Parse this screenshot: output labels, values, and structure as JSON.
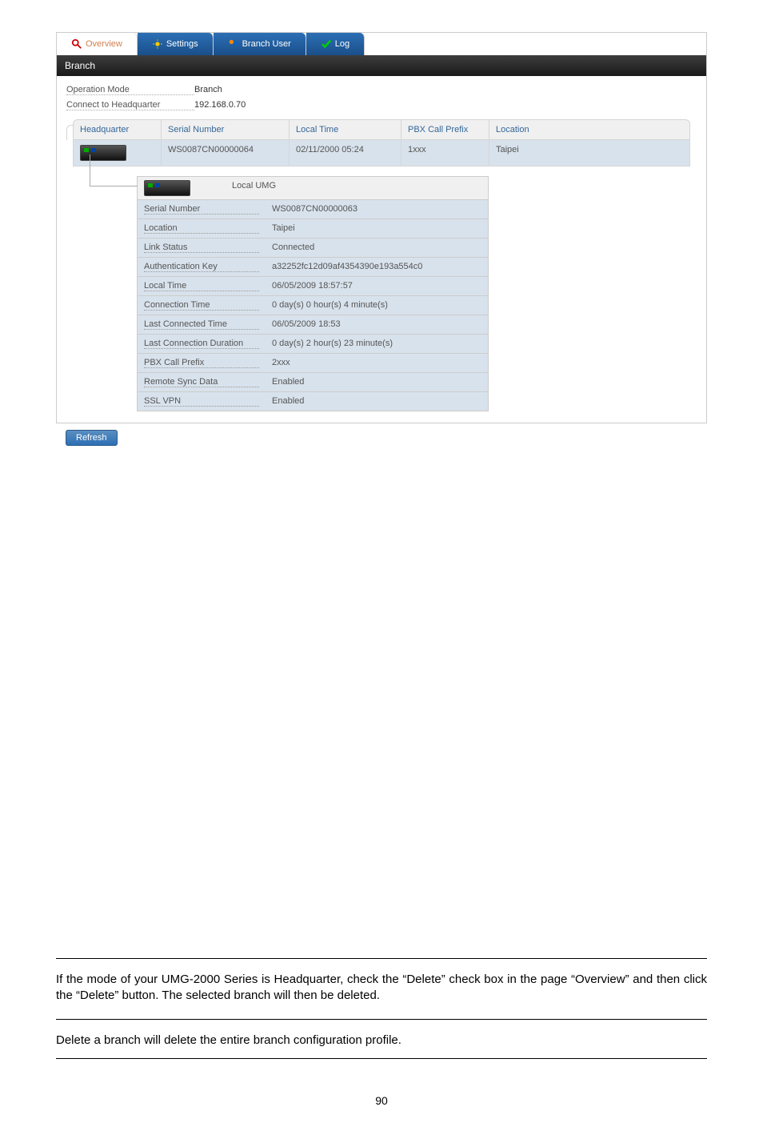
{
  "tabs": {
    "overview": "Overview",
    "settings": "Settings",
    "branch_user": "Branch User",
    "log": "Log"
  },
  "section_title": "Branch",
  "info": {
    "op_mode_label": "Operation Mode",
    "op_mode_value": "Branch",
    "connect_label": "Connect to Headquarter",
    "connect_value": "192.168.0.70"
  },
  "table_headers": {
    "hq": "Headquarter",
    "sn": "Serial Number",
    "lt": "Local Time",
    "pbx": "PBX Call Prefix",
    "loc": "Location"
  },
  "table_row": {
    "sn": "WS0087CN00000064",
    "lt": "02/11/2000 05:24",
    "pbx": "1xxx",
    "loc": "Taipei"
  },
  "detail_header": "Local UMG",
  "details": [
    {
      "label": "Serial Number",
      "value": "WS0087CN00000063"
    },
    {
      "label": "Location",
      "value": "Taipei"
    },
    {
      "label": "Link Status",
      "value": "Connected"
    },
    {
      "label": "Authentication Key",
      "value": "a32252fc12d09af4354390e193a554c0"
    },
    {
      "label": "Local Time",
      "value": "06/05/2009 18:57:57"
    },
    {
      "label": "Connection Time",
      "value": "0 day(s) 0 hour(s) 4 minute(s)"
    },
    {
      "label": "Last Connected Time",
      "value": "06/05/2009 18:53"
    },
    {
      "label": "Last Connection Duration",
      "value": "0 day(s) 2 hour(s) 23 minute(s)"
    },
    {
      "label": "PBX Call Prefix",
      "value": "2xxx"
    },
    {
      "label": "Remote Sync Data",
      "value": "Enabled"
    },
    {
      "label": "SSL VPN",
      "value": "Enabled"
    }
  ],
  "refresh_btn": "Refresh",
  "paragraph1": "If the mode of your UMG-2000 Series is Headquarter, check the “Delete” check box in the page “Overview” and then click the “Delete” button. The selected branch will then be deleted.",
  "paragraph2": "Delete a branch will delete the entire branch configuration profile.",
  "page_number": "90"
}
